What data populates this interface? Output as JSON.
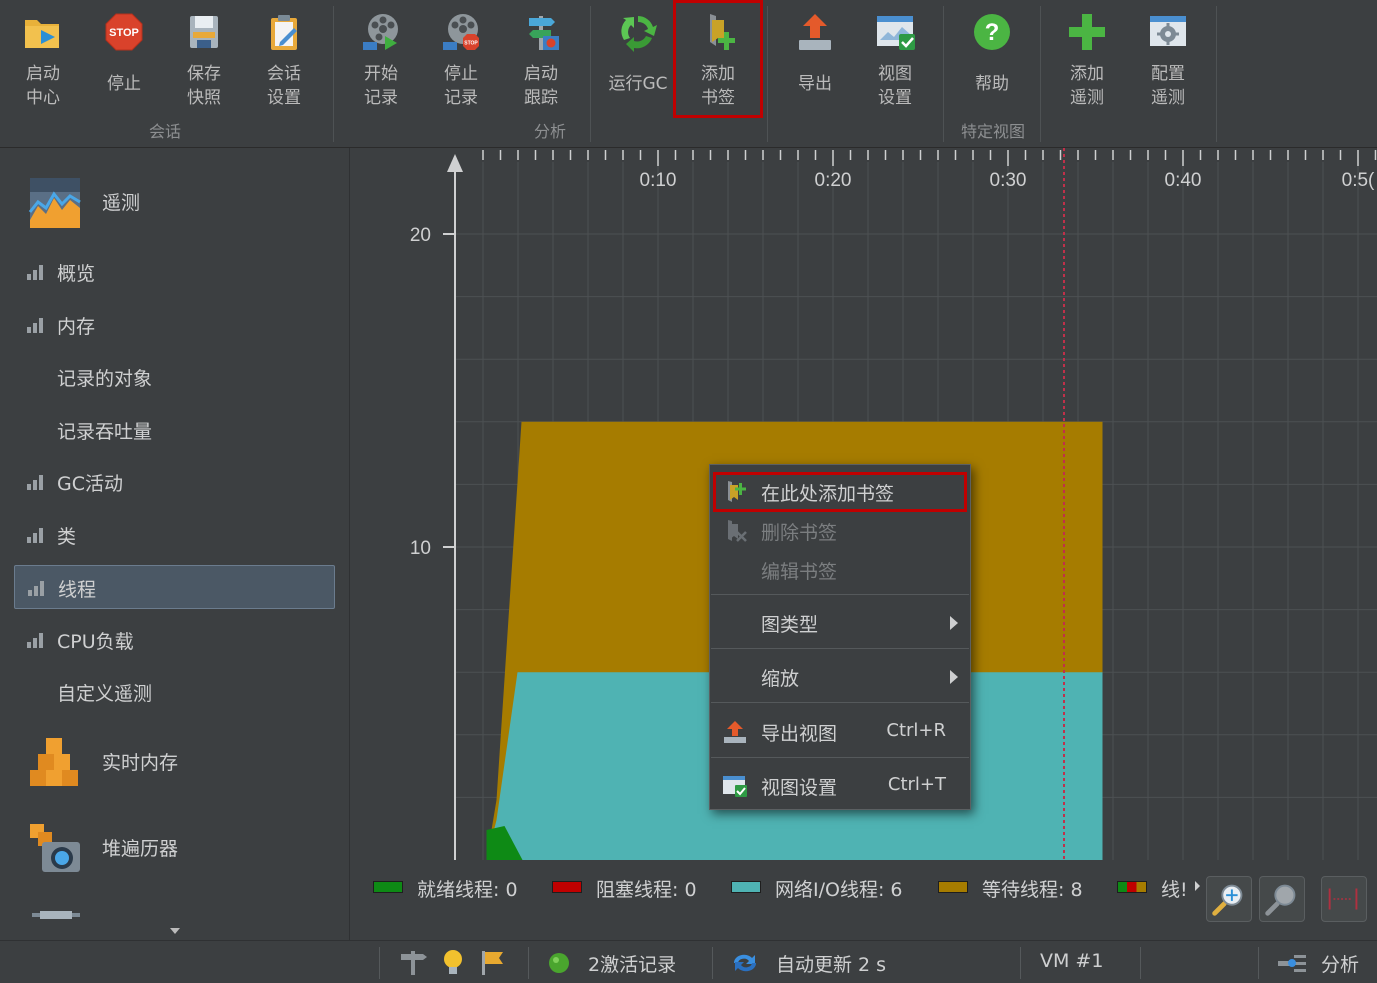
{
  "toolbar": {
    "buttons": {
      "start_center": "启动\n中心",
      "stop": "停止",
      "save_snapshot": "保存\n快照",
      "session_settings": "会话\n设置",
      "start_recording": "开始\n记录",
      "stop_recording": "停止\n记录",
      "start_tracking": "启动\n跟踪",
      "run_gc": "运行GC",
      "add_bookmark": "添加\n书签",
      "export": "导出",
      "view_settings": "视图\n设置",
      "help": "帮助",
      "add_telemetry": "添加\n遥测",
      "configure_telemetry": "配置\n遥测"
    },
    "groups": {
      "session": "会话",
      "analysis": "分析",
      "view_specific": "特定视图"
    },
    "stop_icon_text": "STOP",
    "stop_small_text": "STOP"
  },
  "sidebar": {
    "telemetry": "遥测",
    "items": [
      {
        "label": "概览",
        "has_icon": true
      },
      {
        "label": "内存",
        "has_icon": true
      },
      {
        "label": "记录的对象",
        "has_icon": false
      },
      {
        "label": "记录吞吐量",
        "has_icon": false
      },
      {
        "label": "GC活动",
        "has_icon": true
      },
      {
        "label": "类",
        "has_icon": true
      },
      {
        "label": "线程",
        "has_icon": true,
        "selected": true
      },
      {
        "label": "CPU负载",
        "has_icon": true
      },
      {
        "label": "自定义遥测",
        "has_icon": false
      }
    ],
    "live_memory": "实时内存",
    "heap_walker": "堆遍历器"
  },
  "chart_data": {
    "type": "area",
    "x_ticks": [
      "0:10",
      "0:20",
      "0:30",
      "0:40",
      "0:5("
    ],
    "y_ticks": [
      "20",
      "10"
    ],
    "ylim": [
      0,
      20
    ],
    "series": [
      {
        "name": "就绪线程",
        "color": "#0e8a15",
        "final_value": 0
      },
      {
        "name": "阻塞线程",
        "color": "#c00000",
        "final_value": 0
      },
      {
        "name": "网络I/O线程",
        "color": "#4fb3b3",
        "final_value": 6
      },
      {
        "name": "等待线程",
        "color": "#a67c00",
        "final_value": 8
      }
    ],
    "bookmark_time": "0:33"
  },
  "legend": {
    "ready": {
      "label": "就绪线程:",
      "value": "0"
    },
    "blocked": {
      "label": "阻塞线程:",
      "value": "0"
    },
    "netio": {
      "label": "网络I/O线程:",
      "value": "6"
    },
    "waiting": {
      "label": "等待线程:",
      "value": "8"
    },
    "more": "线!"
  },
  "context_menu": {
    "add_bookmark_here": "在此处添加书签",
    "delete_bookmark": "删除书签",
    "edit_bookmark": "编辑书签",
    "chart_type": "图类型",
    "zoom": "缩放",
    "export_view": "导出视图",
    "export_view_shortcut": "Ctrl+R",
    "view_settings": "视图设置",
    "view_settings_shortcut": "Ctrl+T"
  },
  "status": {
    "active_recordings": "2激活记录",
    "auto_update": "自动更新 2 s",
    "vm": "VM #1",
    "analysis": "分析"
  },
  "colors": {
    "background": "#3c3f41",
    "chart_bg": "#3c3f41",
    "waiting": "#a67c00",
    "netio": "#4fb3b3",
    "ready": "#0e8a15",
    "blocked": "#c00000",
    "highlight": "#c00000",
    "bookmark_line": "#c0304a"
  }
}
